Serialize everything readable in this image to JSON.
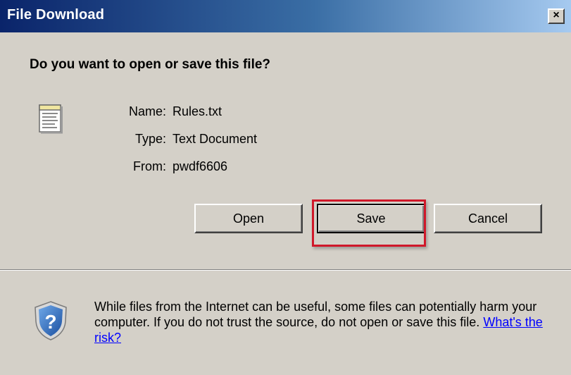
{
  "window": {
    "title": "File Download",
    "close_label": "×"
  },
  "dialog": {
    "question": "Do you want to open or save this file?",
    "file_icon": "text-document-icon",
    "fields": [
      {
        "label": "Name:",
        "value": "Rules.txt"
      },
      {
        "label": "Type:",
        "value": "Text Document"
      },
      {
        "label": "From:",
        "value": "pwdf6606"
      }
    ]
  },
  "buttons": {
    "open": "Open",
    "save": "Save",
    "cancel": "Cancel"
  },
  "warning": {
    "icon": "security-shield-question-icon",
    "text": "While files from the Internet can be useful, some files can potentially harm your computer. If you do not trust the source, do not open or save this file.",
    "link": "What's the risk?"
  },
  "colors": {
    "titlebar_start": "#0a246a",
    "titlebar_end": "#a6caf0",
    "dialog_bg": "#d4d0c8",
    "highlight": "#d0182a",
    "link": "#0000ff"
  }
}
